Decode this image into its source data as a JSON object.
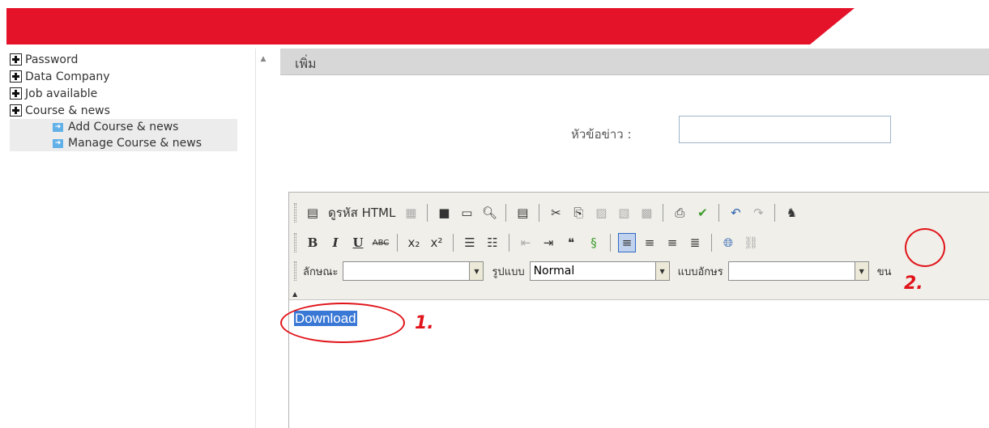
{
  "colors": {
    "banner_red": "#e5132a",
    "accent_blue": "#3a78d6",
    "annotation_red": "#e0141a"
  },
  "sidebar": {
    "items": [
      {
        "label": "Password"
      },
      {
        "label": "Data Company"
      },
      {
        "label": "Job available"
      },
      {
        "label": "Course & news"
      }
    ],
    "subitems": [
      {
        "label": "Add Course & news"
      },
      {
        "label": "Manage Course & news"
      }
    ]
  },
  "main": {
    "section_title": "เพิ่ม",
    "headline_label": "หัวข้อข่าว :",
    "headline_value": ""
  },
  "editor": {
    "source_label": "ดูรหัส HTML",
    "style_label": "ลักษณะ",
    "style_value": "",
    "format_label": "รูปแบบ",
    "format_value": "Normal",
    "font_label": "แบบอักษร",
    "font_value": "",
    "size_label": "ขน",
    "content_text": "Download",
    "icons": [
      "source-icon",
      "paste-icon",
      "save-icon",
      "new-page-icon",
      "preview-icon",
      "template-icon",
      "cut-icon",
      "copy-icon",
      "paste-text-icon",
      "paste-word-icon",
      "print-icon",
      "spellcheck-icon",
      "undo-icon",
      "redo-icon",
      "bold-icon",
      "italic-icon",
      "underline-icon",
      "strikethrough-icon",
      "subscript-icon",
      "superscript-icon",
      "ordered-list-icon",
      "bullet-list-icon",
      "outdent-icon",
      "indent-icon",
      "blockquote-icon",
      "div-icon",
      "align-left-icon",
      "align-center-icon",
      "align-right-icon",
      "justify-icon",
      "link-icon",
      "unlink-icon"
    ]
  },
  "annotations": {
    "step1": "1.",
    "step2": "2."
  }
}
